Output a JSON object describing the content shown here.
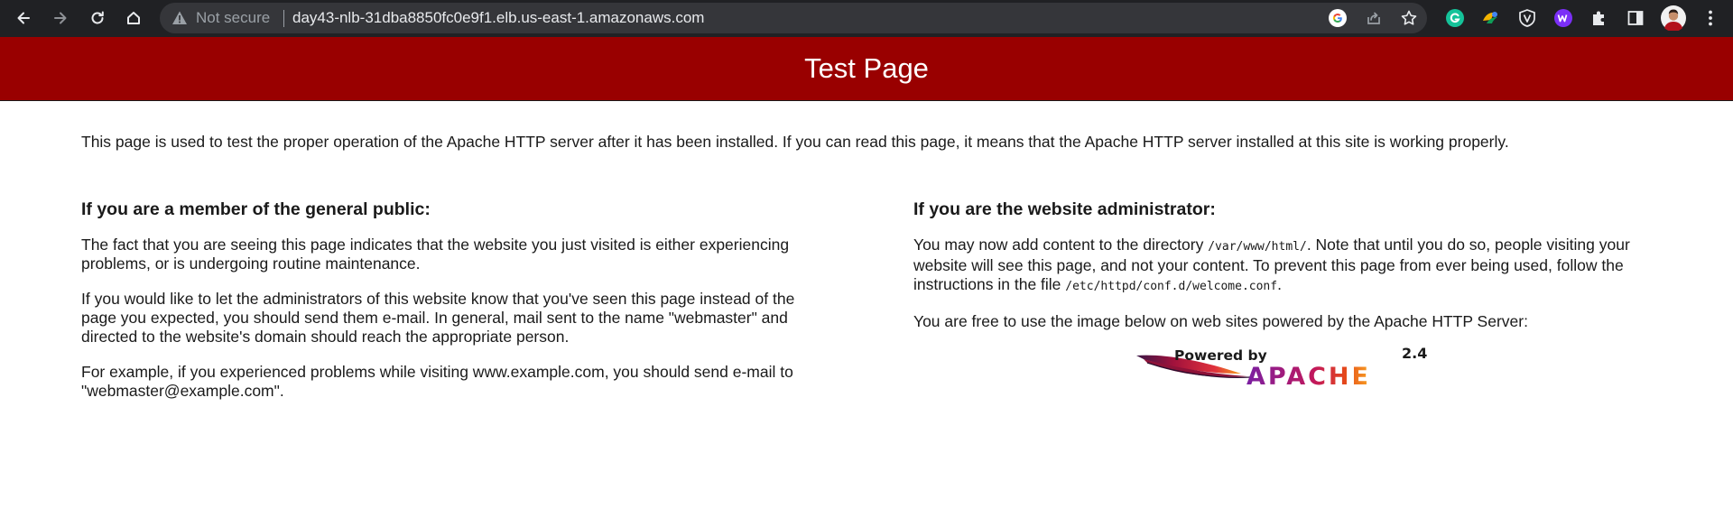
{
  "browser": {
    "security_label": "Not secure",
    "url": "day43-nlb-31dba8850fc0e9f1.elb.us-east-1.amazonaws.com",
    "nav_icons": [
      "back-arrow-icon",
      "forward-arrow-icon",
      "reload-icon",
      "home-icon"
    ],
    "omnibox_icons": [
      "google-icon",
      "share-icon",
      "bookmark-star-icon"
    ],
    "extension_icons": [
      "grammarly-icon",
      "extension-color-icon",
      "shield-extension-icon",
      "w-extension-icon",
      "puzzle-extensions-icon",
      "side-panel-icon",
      "profile-avatar",
      "menu-kebab-icon"
    ]
  },
  "page": {
    "title": "Test Page",
    "intro": "This page is used to test the proper operation of the Apache HTTP server after it has been installed. If you can read this page, it means that the Apache HTTP server installed at this site is working properly.",
    "public": {
      "heading": "If you are a member of the general public:",
      "p1": "The fact that you are seeing this page indicates that the website you just visited is either experiencing problems, or is undergoing routine maintenance.",
      "p2": "If you would like to let the administrators of this website know that you've seen this page instead of the page you expected, you should send them e-mail. In general, mail sent to the name \"webmaster\" and directed to the website's domain should reach the appropriate person.",
      "p3": "For example, if you experienced problems while visiting www.example.com, you should send e-mail to \"webmaster@example.com\"."
    },
    "admin": {
      "heading": "If you are the website administrator:",
      "p1_a": "You may now add content to the directory ",
      "p1_dir": "/var/www/html/",
      "p1_b": ". Note that until you do so, people visiting your website will see this page, and not your content. To prevent this page from ever being used, follow the instructions in the file ",
      "p1_file": "/etc/httpd/conf.d/welcome.conf",
      "p1_c": ".",
      "p2": "You are free to use the image below on web sites powered by the Apache HTTP Server:"
    },
    "badge": {
      "powered_by": "Powered by",
      "version": "2.4",
      "brand": "APACHE"
    }
  }
}
